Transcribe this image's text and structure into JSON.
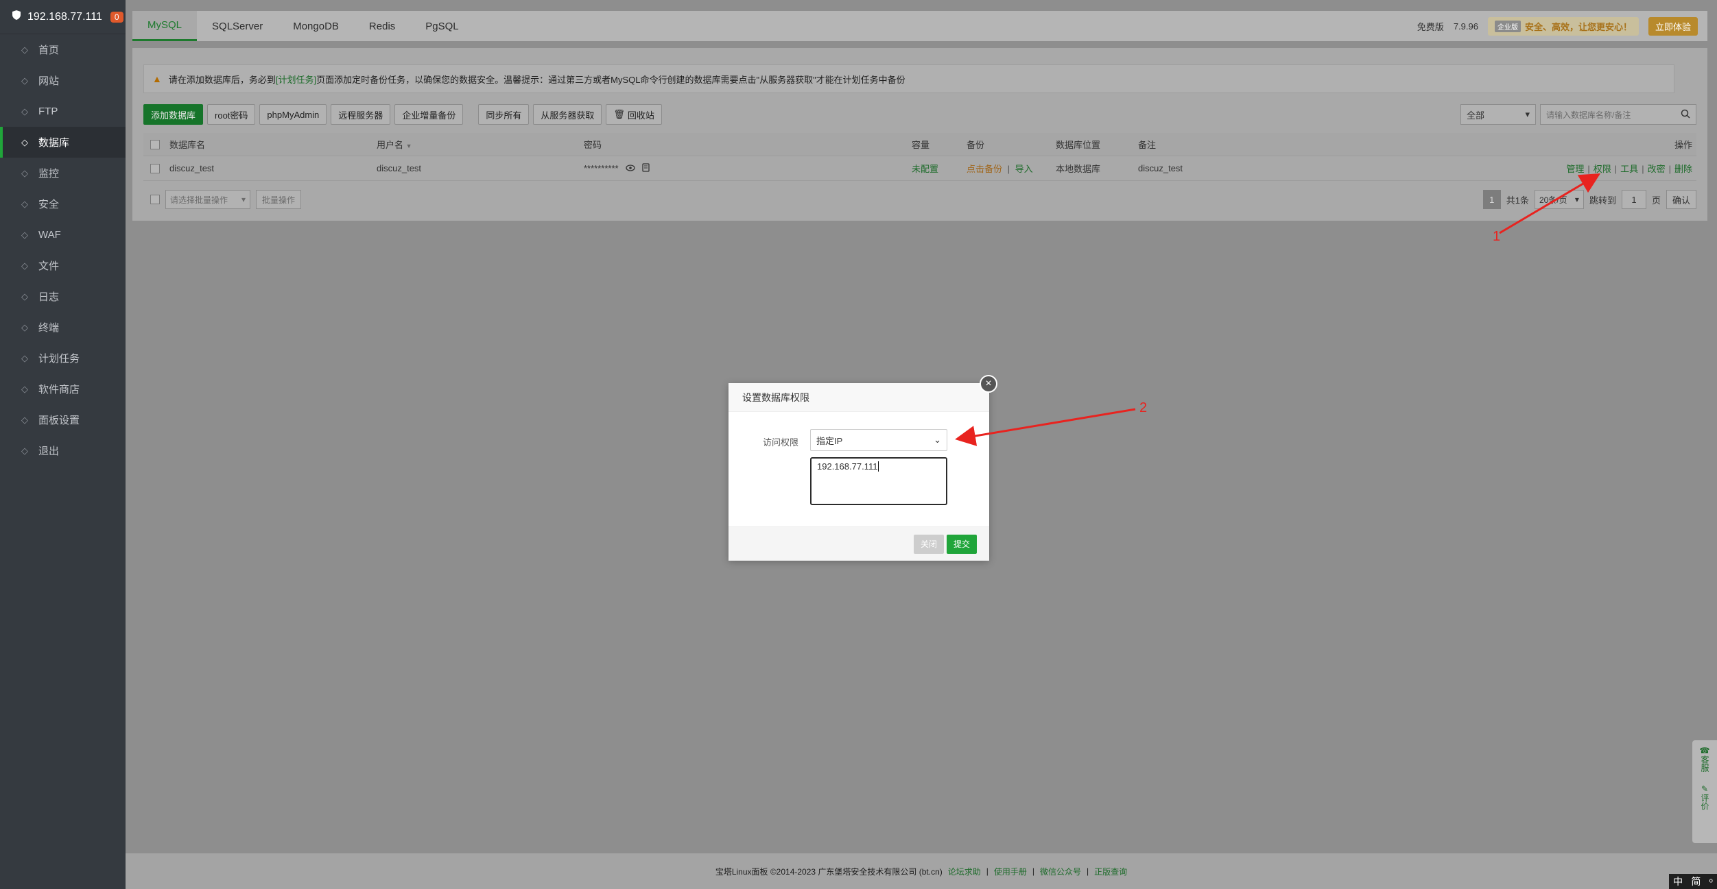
{
  "sidebar": {
    "server_ip": "192.168.77.111",
    "badge": "0",
    "items": [
      {
        "label": "首页",
        "icon": "home-icon"
      },
      {
        "label": "网站",
        "icon": "globe-icon"
      },
      {
        "label": "FTP",
        "icon": "ftp-icon"
      },
      {
        "label": "数据库",
        "icon": "database-icon",
        "active": true
      },
      {
        "label": "监控",
        "icon": "monitor-icon"
      },
      {
        "label": "安全",
        "icon": "shield-icon"
      },
      {
        "label": "WAF",
        "icon": "waf-icon"
      },
      {
        "label": "文件",
        "icon": "folder-icon"
      },
      {
        "label": "日志",
        "icon": "log-icon"
      },
      {
        "label": "终端",
        "icon": "terminal-icon"
      },
      {
        "label": "计划任务",
        "icon": "calendar-icon"
      },
      {
        "label": "软件商店",
        "icon": "apps-icon"
      },
      {
        "label": "面板设置",
        "icon": "settings-icon"
      },
      {
        "label": "退出",
        "icon": "logout-icon"
      }
    ]
  },
  "tabs": [
    "MySQL",
    "SQLServer",
    "MongoDB",
    "Redis",
    "PgSQL"
  ],
  "topbar": {
    "edition": "免费版",
    "version": "7.9.96",
    "promo_tag": "企业版",
    "promo_text": "安全、高效，让您更安心！",
    "try_label": "立即体验"
  },
  "warning": {
    "text_before": "请在添加数据库后，务必到",
    "link": "[计划任务]",
    "text_after": "页面添加定时备份任务，以确保您的数据安全。温馨提示：通过第三方或者MySQL命令行创建的数据库需要点击\"从服务器获取\"才能在计划任务中备份"
  },
  "toolbar": {
    "add_db": "添加数据库",
    "root_pwd": "root密码",
    "phpmyadmin": "phpMyAdmin",
    "remote": "远程服务器",
    "enterprise_backup": "企业增量备份",
    "sync_all": "同步所有",
    "from_server": "从服务器获取",
    "recycle": "回收站",
    "filter": "全部",
    "search_placeholder": "请输入数据库名称/备注"
  },
  "table": {
    "headers": {
      "name": "数据库名",
      "user": "用户名",
      "password": "密码",
      "size": "容量",
      "backup": "备份",
      "location": "数据库位置",
      "note": "备注",
      "ops": "操作"
    },
    "rows": [
      {
        "name": "discuz_test",
        "user": "discuz_test",
        "password": "**********",
        "size": "未配置",
        "backup": "点击备份",
        "import": "导入",
        "location": "本地数据库",
        "note": "discuz_test",
        "ops": [
          "管理",
          "权限",
          "工具",
          "改密",
          "删除"
        ]
      }
    ]
  },
  "bottom": {
    "batch_placeholder": "请选择批量操作",
    "batch_btn": "批量操作",
    "page": "1",
    "total": "共1条",
    "per_page": "20条/页",
    "jump_label": "跳转到",
    "jump_value": "1",
    "page_unit": "页",
    "confirm": "确认"
  },
  "footer": {
    "copyright": "宝塔Linux面板 ©2014-2023 广东堡塔安全技术有限公司 (bt.cn)",
    "links": [
      "论坛求助",
      "使用手册",
      "微信公众号",
      "正版查询"
    ]
  },
  "float": {
    "service": "客服",
    "review": "评价"
  },
  "ime": {
    "lang": "中",
    "mode": "简"
  },
  "modal": {
    "title": "设置数据库权限",
    "label": "访问权限",
    "select_value": "指定IP",
    "textarea_value": "192.168.77.111",
    "close_label": "关闭",
    "submit_label": "提交"
  },
  "annotations": [
    "1",
    "2"
  ],
  "colors": {
    "accent": "#20a53a",
    "sidebar_bg": "#353a40",
    "arrow": "#e8231f"
  }
}
